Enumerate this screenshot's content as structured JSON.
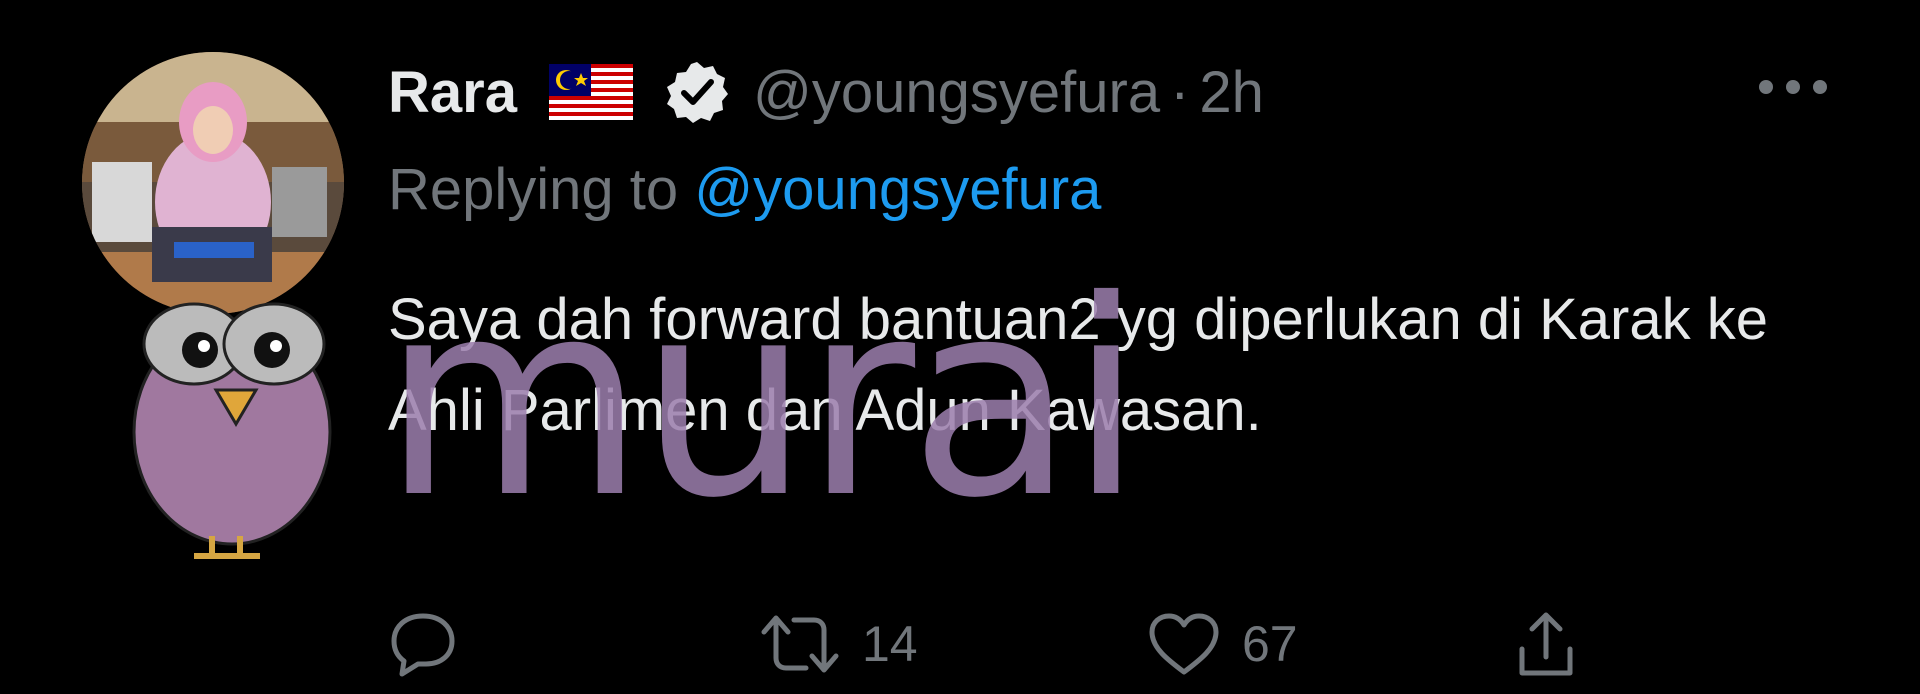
{
  "tweet": {
    "display_name": "Rara",
    "handle": "@youngsyefura",
    "separator": "·",
    "time": "2h",
    "reply_prefix": "Replying to",
    "reply_to": "@youngsyefura",
    "text": "Saya dah forward bantuan2 yg diperlukan di Karak ke Ahli Parlimen dan Adun Kawasan.",
    "flag_icon": "malaysia-flag-icon",
    "verified_icon": "verified-badge-icon"
  },
  "actions": {
    "reply_icon": "reply-icon",
    "retweet_icon": "retweet-icon",
    "retweet_count": "14",
    "like_icon": "heart-icon",
    "like_count": "67",
    "share_icon": "share-icon"
  },
  "watermark": {
    "text": "murai"
  },
  "colors": {
    "background": "#000000",
    "primary_text": "#e7e9ea",
    "secondary_text": "#71767b",
    "link": "#1d9bf0",
    "watermark": "#9d7fae"
  }
}
